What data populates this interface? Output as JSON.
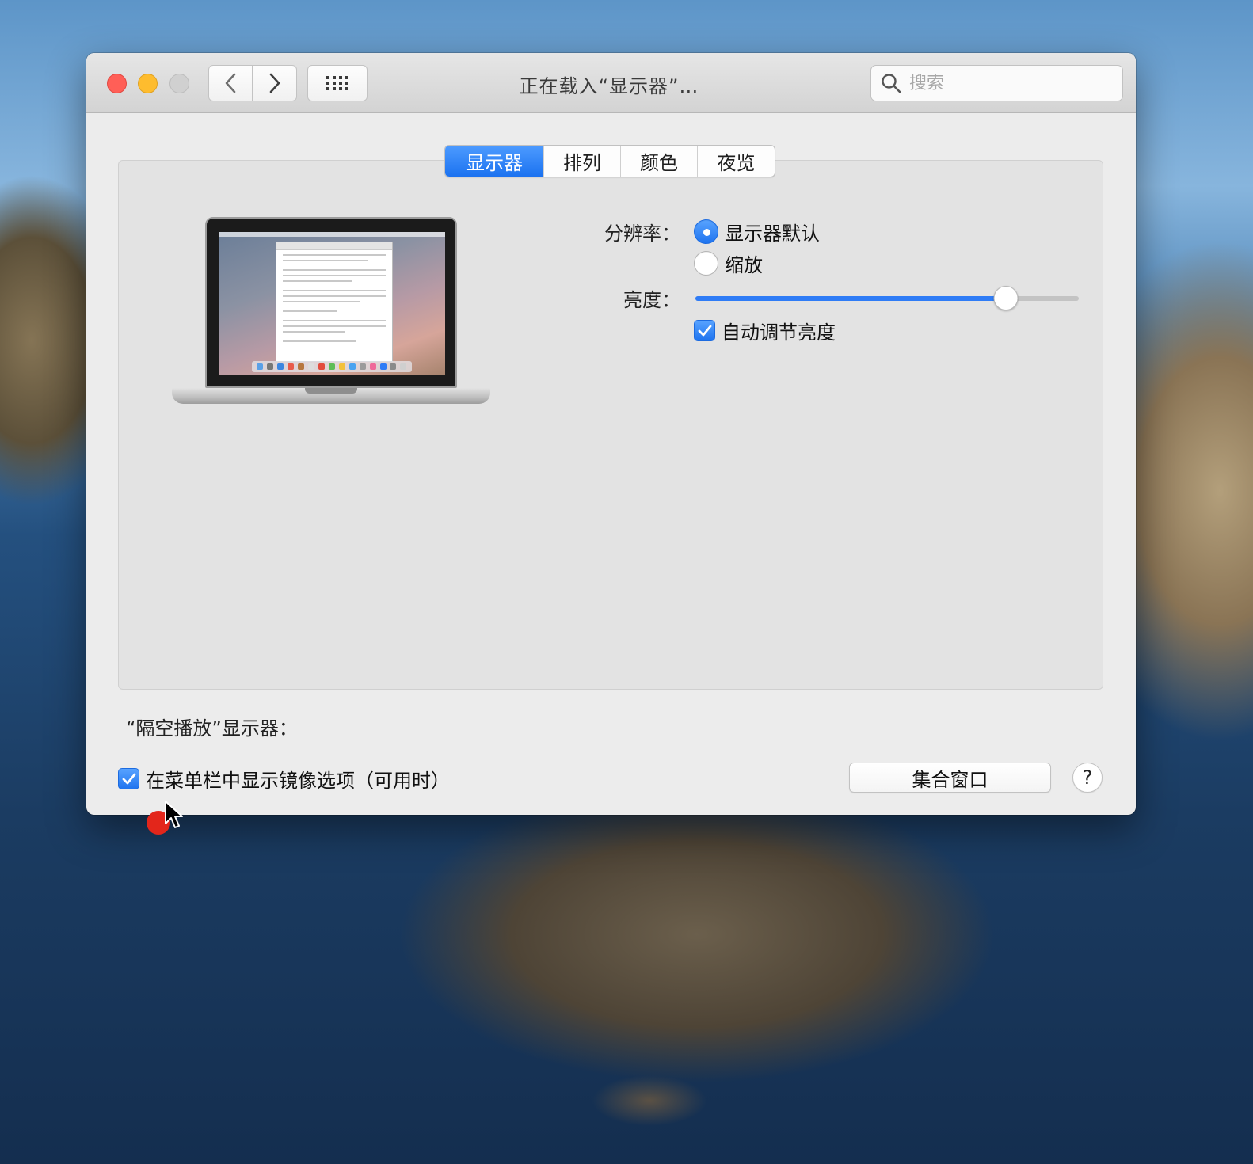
{
  "window": {
    "title": "正在载入“显示器”…"
  },
  "toolbar": {
    "back_icon": "chevron-left-icon",
    "forward_icon": "chevron-right-icon",
    "grid_icon": "grid-icon",
    "search_placeholder": "搜索"
  },
  "tabs": [
    {
      "label": "显示器",
      "active": true
    },
    {
      "label": "排列",
      "active": false
    },
    {
      "label": "颜色",
      "active": false
    },
    {
      "label": "夜览",
      "active": false
    }
  ],
  "display": {
    "resolution_label": "分辨率：",
    "resolution_options": [
      {
        "label": "显示器默认",
        "selected": true
      },
      {
        "label": "缩放",
        "selected": false
      }
    ],
    "brightness_label": "亮度：",
    "brightness_value": 0.81,
    "auto_brightness_label": "自动调节亮度",
    "auto_brightness_checked": true
  },
  "airplay": {
    "label": "“隔空播放”显示器：",
    "mirror_option_label": "在菜单栏中显示镜像选项（可用时）",
    "mirror_option_checked": true
  },
  "buttons": {
    "gather_windows": "集合窗口",
    "help": "?"
  },
  "colors": {
    "accent": "#2f7cf6",
    "close": "#ff5f57",
    "minimize": "#febc2e",
    "recording": "#e3261b"
  }
}
